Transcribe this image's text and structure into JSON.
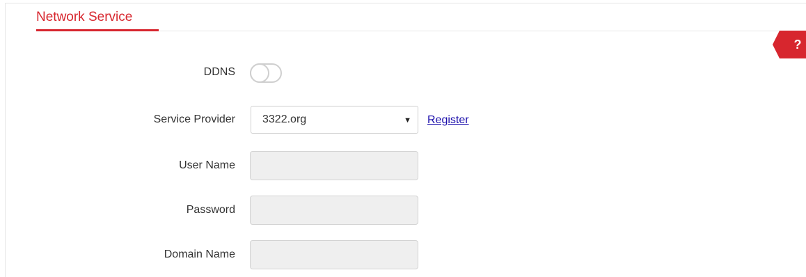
{
  "section": {
    "title": "Network Service"
  },
  "help": {
    "label": "?"
  },
  "form": {
    "ddns": {
      "label": "DDNS",
      "enabled": false
    },
    "service_provider": {
      "label": "Service Provider",
      "selected": "3322.org",
      "arrow": "▼"
    },
    "register": {
      "label": "Register"
    },
    "user_name": {
      "label": "User Name",
      "value": "",
      "disabled": true
    },
    "password": {
      "label": "Password",
      "value": "",
      "disabled": true
    },
    "domain_name": {
      "label": "Domain Name",
      "value": "",
      "disabled": true
    }
  },
  "colors": {
    "accent": "#d7262e",
    "link": "#1a0dab",
    "disabled_field": "#efefef"
  }
}
